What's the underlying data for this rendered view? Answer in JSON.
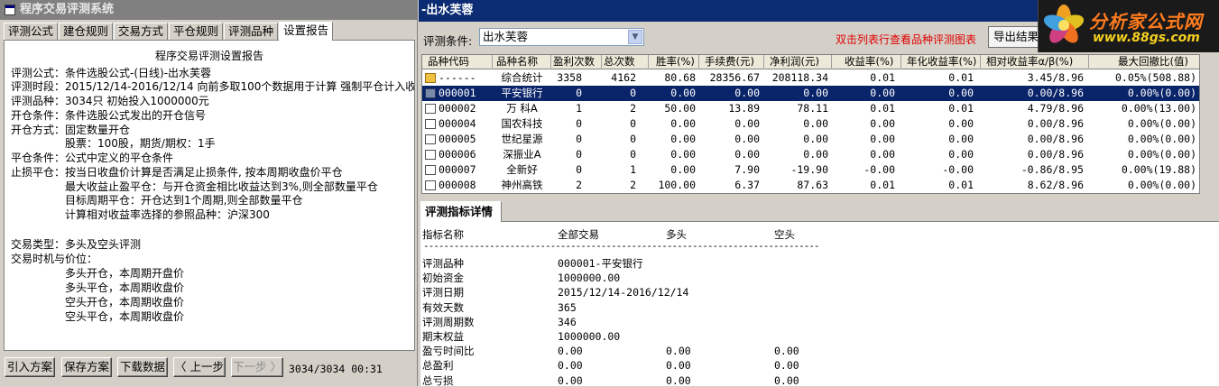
{
  "left_window": {
    "title": "程序交易评测系统",
    "tabs": [
      "评测公式",
      "建仓规则",
      "交易方式",
      "平仓规则",
      "评测品种",
      "设置报告"
    ],
    "active_tab": 5,
    "report": {
      "title": "程序交易评测设置报告",
      "lines": [
        "评测公式：条件选股公式-(日线)-出水芙蓉",
        "评测时段：2015/12/14-2016/12/14 向前多取100个数据用于计算 强制平仓计入收益",
        "评测品种：3034只 初始投入1000000元",
        "开仓条件：条件选股公式发出的开仓信号",
        "开仓方式：固定数量开仓",
        "股票：100股，期货/期权：1手",
        "平仓条件：公式中定义的平仓条件",
        "止损平仓：按当日收盘价计算是否满足止损条件, 按本周期收盘价平仓",
        "最大收益止盈平仓：与开仓资金相比收益达到3%,则全部数量平仓",
        "目标周期平仓：开仓达到1个周期,则全部数量平仓",
        "计算相对收益率选择的参照品种：沪深300",
        "交易类型：多头及空头评测",
        "交易时机与价位：",
        "多头开仓，本周期开盘价",
        "多头平仓，本周期收盘价",
        "空头开仓，本周期收盘价",
        "空头平仓，本周期收盘价"
      ]
    },
    "buttons": {
      "import": "引入方案",
      "save": "保存方案",
      "download": "下载数据",
      "prev": "〈 上一步",
      "next": "下一步 〉"
    },
    "page_indicator": "3034/3034 00:31"
  },
  "right_window": {
    "title": "-出水芙蓉",
    "filter_label": "评测条件:",
    "filter_value": "出水芙蓉",
    "hint": "双击列表行查看品种评测图表",
    "export_button": "导出结果",
    "grid": {
      "columns": [
        "品种代码",
        "品种名称",
        "盈利次数",
        "总次数",
        "胜率(%)",
        "手续费(元)",
        "净利润(元)",
        "收益率(%)",
        "年化收益率(%)",
        "相对收益率α/β(%)",
        "最大回撤比(值)"
      ],
      "rows": [
        {
          "code": "------",
          "name": "综合统计",
          "win": "3358",
          "total": "4162",
          "rate": "80.68",
          "fee": "28356.67",
          "profit": "208118.34",
          "ret": "0.01",
          "annual": "0.01",
          "relative": "3.45/8.96",
          "drawdown": "0.05%(508.88)",
          "icon": "folder",
          "selected": false
        },
        {
          "code": "000001",
          "name": "平安银行",
          "win": "0",
          "total": "0",
          "rate": "0.00",
          "fee": "0.00",
          "profit": "0.00",
          "ret": "0.00",
          "annual": "0.00",
          "relative": "0.00/8.96",
          "drawdown": "0.00%(0.00)",
          "icon": "dark",
          "selected": true
        },
        {
          "code": "000002",
          "name": "万 科A",
          "win": "1",
          "total": "2",
          "rate": "50.00",
          "fee": "13.89",
          "profit": "78.11",
          "ret": "0.01",
          "annual": "0.01",
          "relative": "4.79/8.96",
          "drawdown": "0.00%(13.00)",
          "icon": "doc",
          "selected": false
        },
        {
          "code": "000004",
          "name": "国农科技",
          "win": "0",
          "total": "0",
          "rate": "0.00",
          "fee": "0.00",
          "profit": "0.00",
          "ret": "0.00",
          "annual": "0.00",
          "relative": "0.00/8.96",
          "drawdown": "0.00%(0.00)",
          "icon": "doc",
          "selected": false
        },
        {
          "code": "000005",
          "name": "世纪星源",
          "win": "0",
          "total": "0",
          "rate": "0.00",
          "fee": "0.00",
          "profit": "0.00",
          "ret": "0.00",
          "annual": "0.00",
          "relative": "0.00/8.96",
          "drawdown": "0.00%(0.00)",
          "icon": "doc",
          "selected": false
        },
        {
          "code": "000006",
          "name": "深振业A",
          "win": "0",
          "total": "0",
          "rate": "0.00",
          "fee": "0.00",
          "profit": "0.00",
          "ret": "0.00",
          "annual": "0.00",
          "relative": "0.00/8.96",
          "drawdown": "0.00%(0.00)",
          "icon": "doc",
          "selected": false
        },
        {
          "code": "000007",
          "name": "全新好",
          "win": "0",
          "total": "1",
          "rate": "0.00",
          "fee": "7.90",
          "profit": "-19.90",
          "ret": "-0.00",
          "annual": "-0.00",
          "relative": "-0.86/8.95",
          "drawdown": "0.00%(19.88)",
          "icon": "doc",
          "selected": false
        },
        {
          "code": "000008",
          "name": "神州高铁",
          "win": "2",
          "total": "2",
          "rate": "100.00",
          "fee": "6.37",
          "profit": "87.63",
          "ret": "0.01",
          "annual": "0.01",
          "relative": "8.62/8.96",
          "drawdown": "0.00%(0.00)",
          "icon": "doc",
          "selected": false
        }
      ]
    },
    "detail": {
      "tab": "评测指标详情",
      "headers": [
        "指标名称",
        "全部交易",
        "多头",
        "空头"
      ],
      "separator": "------------------------------------------------------------------------------------------------------------",
      "rows": [
        {
          "label": "评测品种",
          "all": "000001-平安银行",
          "long": "",
          "short": ""
        },
        {
          "label": "初始资金",
          "all": "1000000.00",
          "long": "",
          "short": ""
        },
        {
          "label": "评测日期",
          "all": "2015/12/14-2016/12/14",
          "long": "",
          "short": ""
        },
        {
          "label": "有效天数",
          "all": "365",
          "long": "",
          "short": ""
        },
        {
          "label": "评测周期数",
          "all": "346",
          "long": "",
          "short": ""
        },
        {
          "label": "期末权益",
          "all": "1000000.00",
          "long": "",
          "short": ""
        },
        {
          "label": "盈亏时间比",
          "all": "0.00",
          "long": "0.00",
          "short": "0.00"
        },
        {
          "label": "总盈利",
          "all": "0.00",
          "long": "0.00",
          "short": "0.00"
        },
        {
          "label": "总亏损",
          "all": "0.00",
          "long": "0.00",
          "short": "0.00"
        }
      ]
    }
  },
  "watermark": {
    "title": "分析家公式网",
    "url": "www.88gs.com"
  }
}
